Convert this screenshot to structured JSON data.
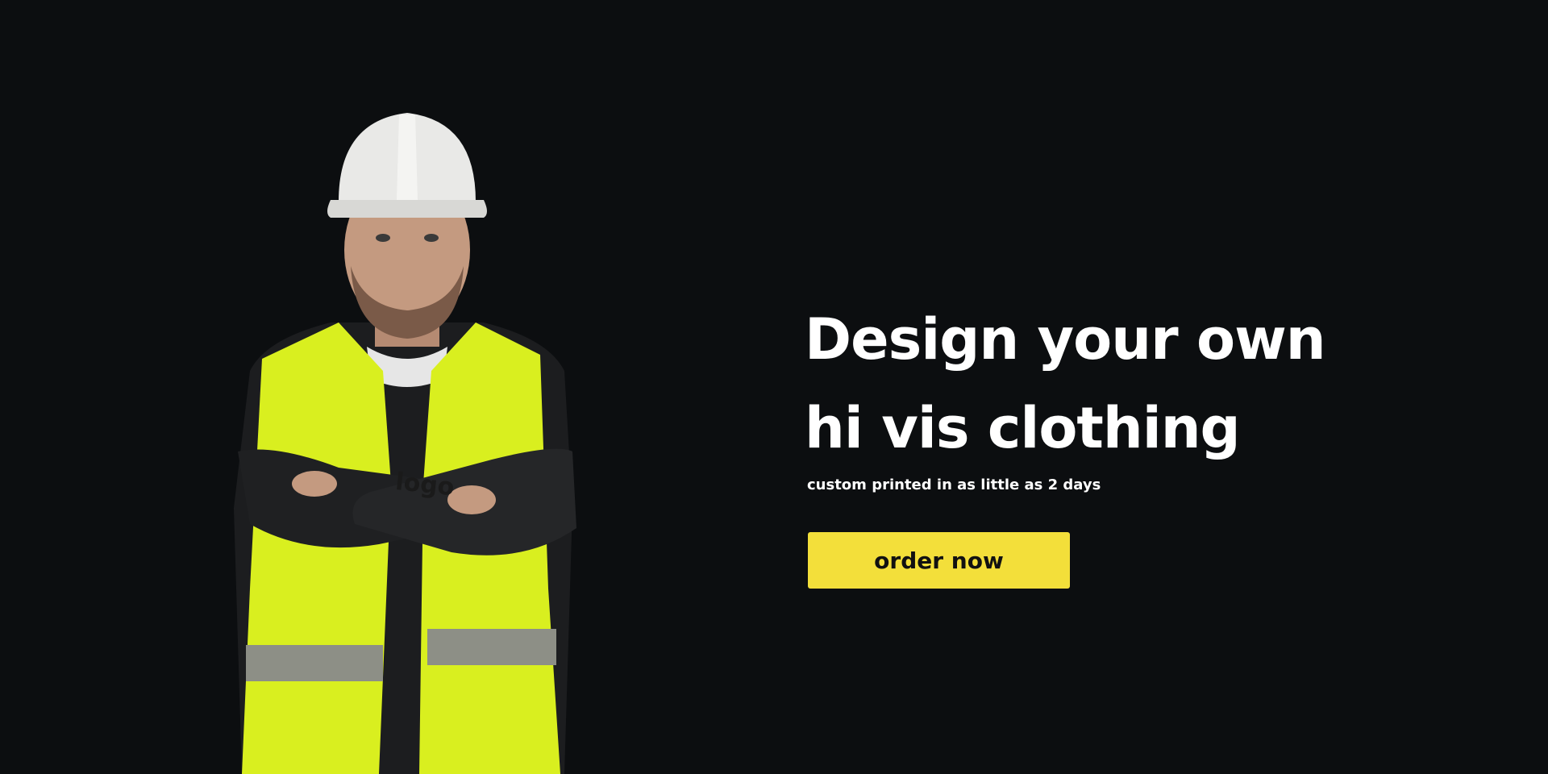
{
  "hero": {
    "headline_line1": "Design your own",
    "headline_line2": "hi vis clothing",
    "subheadline": "custom printed in as little as 2 days",
    "cta_label": "order now",
    "vest_logo_text": "logo"
  },
  "colors": {
    "background": "#0c0e10",
    "accent_yellow": "#f3df3a",
    "vest_yellow": "#d9ef1f",
    "text_white": "#ffffff"
  }
}
